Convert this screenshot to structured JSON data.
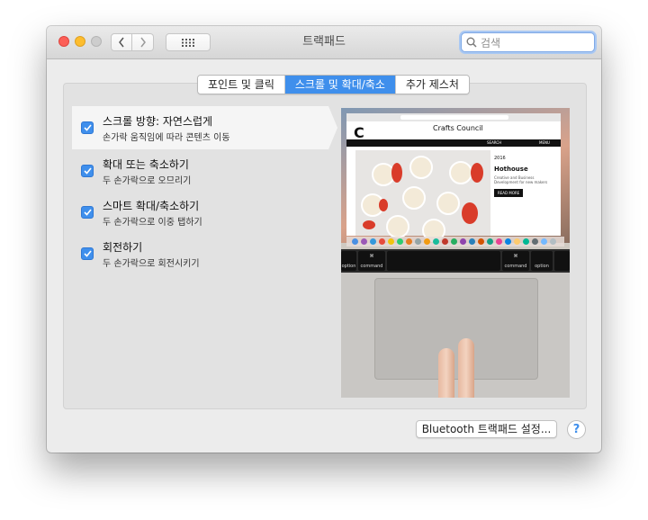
{
  "window": {
    "title": "트랙패드"
  },
  "search": {
    "placeholder": "검색"
  },
  "tabs": [
    {
      "label": "포인트 및 클릭",
      "selected": false
    },
    {
      "label": "스크롤 및 확대/축소",
      "selected": true
    },
    {
      "label": "추가 제스처",
      "selected": false
    }
  ],
  "options": [
    {
      "title": "스크롤 방향: 자연스럽게",
      "subtitle": "손가락 움직임에 따라 콘텐츠 이동",
      "checked": true,
      "selected": true
    },
    {
      "title": "확대 또는 축소하기",
      "subtitle": "두 손가락으로 오므리기",
      "checked": true,
      "selected": false
    },
    {
      "title": "스마트 확대/축소하기",
      "subtitle": "두 손가락으로 이중 탭하기",
      "checked": true,
      "selected": false
    },
    {
      "title": "회전하기",
      "subtitle": "두 손가락으로 회전시키기",
      "checked": true,
      "selected": false
    }
  ],
  "preview": {
    "site_title": "Crafts Council",
    "nav_search": "SEARCH",
    "nav_menu": "MENU",
    "article_date": "2016",
    "article_title": "Hothouse",
    "article_desc": "Creative and Business Development for new makers",
    "article_button": "READ MORE",
    "key_left_symbol": "⌘",
    "key_left_label": "command",
    "key_right_symbol": "⌘",
    "key_right_label": "command",
    "key_option_left": "option",
    "key_option_right": "option"
  },
  "footer": {
    "bluetooth_button": "Bluetooth 트랙패드 설정...",
    "help_label": "?"
  },
  "colors": {
    "accent": "#3f8fec",
    "close": "#fc5f57",
    "minimize": "#fdbd2e"
  }
}
